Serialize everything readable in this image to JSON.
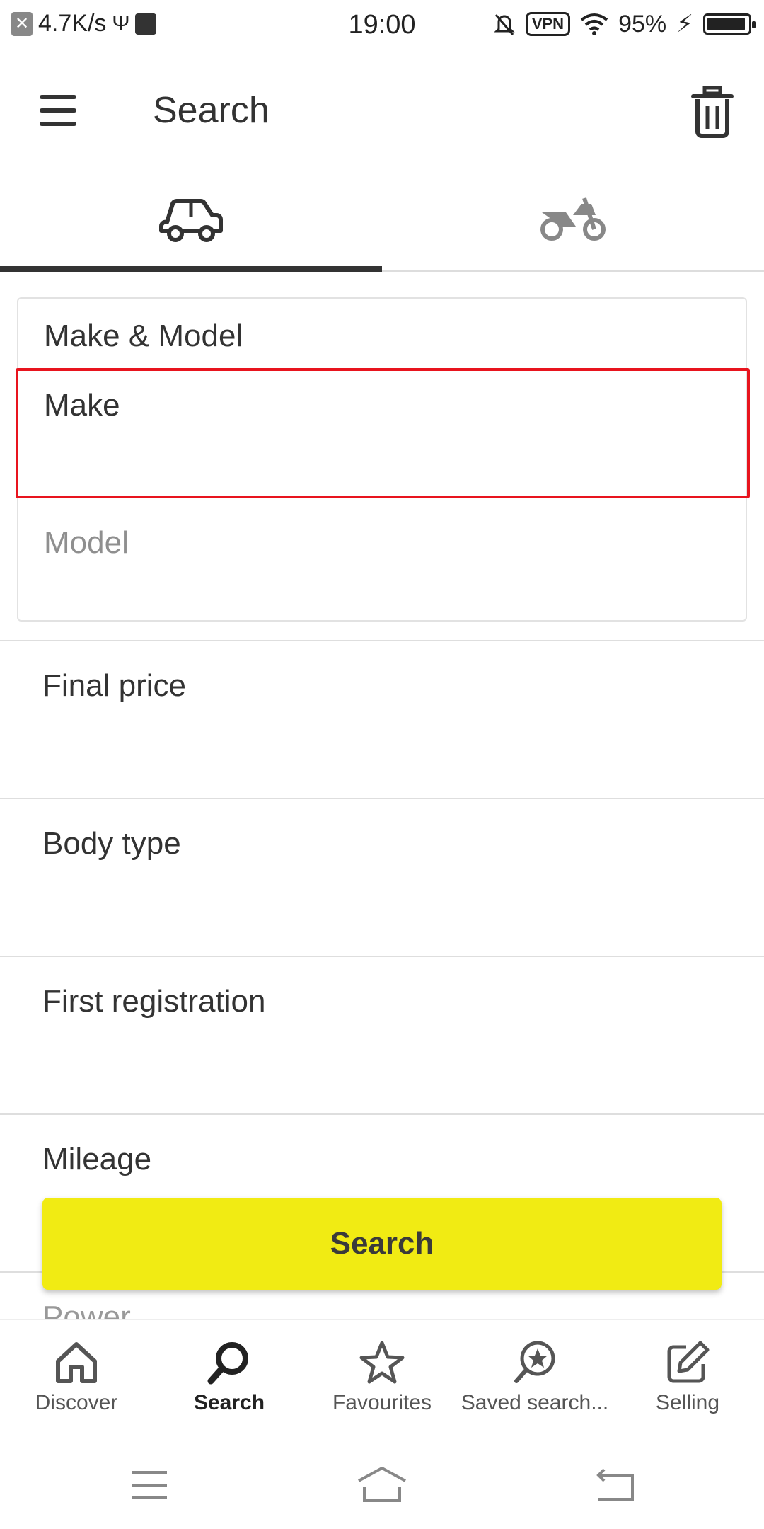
{
  "status_bar": {
    "speed": "4.7K/s",
    "time": "19:00",
    "vpn": "VPN",
    "battery": "95%",
    "battery_level": 0.95
  },
  "app_bar": {
    "title": "Search"
  },
  "tabs": [
    {
      "name": "car",
      "icon": "car-icon",
      "active": true
    },
    {
      "name": "motorbike",
      "icon": "motorbike-icon",
      "active": false
    }
  ],
  "make_model": {
    "title": "Make & Model",
    "make_label": "Make",
    "model_placeholder": "Model"
  },
  "filters": [
    {
      "label": "Final price"
    },
    {
      "label": "Body type"
    },
    {
      "label": "First registration"
    },
    {
      "label": "Mileage"
    },
    {
      "label": "Power"
    }
  ],
  "search_button": "Search",
  "bottom_nav": [
    {
      "label": "Discover",
      "icon": "home-icon",
      "active": false
    },
    {
      "label": "Search",
      "icon": "search-icon",
      "active": true
    },
    {
      "label": "Favourites",
      "icon": "star-icon",
      "active": false
    },
    {
      "label": "Saved search...",
      "icon": "saved-search-icon",
      "active": false
    },
    {
      "label": "Selling",
      "icon": "edit-icon",
      "active": false
    }
  ],
  "colors": {
    "accent": "#f1eb13",
    "highlight_border": "#e8141e",
    "text": "#333333"
  }
}
